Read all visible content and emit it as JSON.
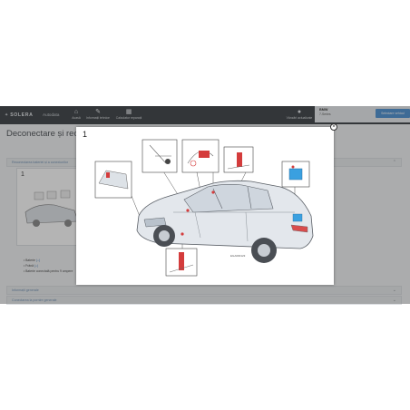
{
  "toolbar": {
    "logo_text": "SOLERA",
    "app_name": "Autodata",
    "nav": [
      {
        "label": "Acasă",
        "icon": "home-icon"
      },
      {
        "label": "Informații tehnice",
        "icon": "wrench-icon"
      },
      {
        "label": "Calculator reparații",
        "icon": "calculator-icon"
      }
    ],
    "notifications_label": "Vânzări actualizate"
  },
  "vehicle": {
    "make": "BMW",
    "series": "7-Series",
    "select_button": "Selectare vehicul"
  },
  "page": {
    "title": "Deconectare și reco",
    "sections": [
      "Reconectarea bateriei și a conexiunilor",
      "Informații generale",
      "Conectarea la pornire generale"
    ],
    "panel_number": "1",
    "bullets": [
      "Baterie",
      "Frână",
      "Baterie conectată pentru 9 ampere"
    ]
  },
  "modal": {
    "number": "1",
    "close_label": "×",
    "figure_code": "EGA000123"
  },
  "colors": {
    "toolbar": "#3a3e42",
    "accent_blue": "#4b8fd1",
    "battery_highlight": "#3aa0e0",
    "red_marker": "#d43c3c"
  }
}
